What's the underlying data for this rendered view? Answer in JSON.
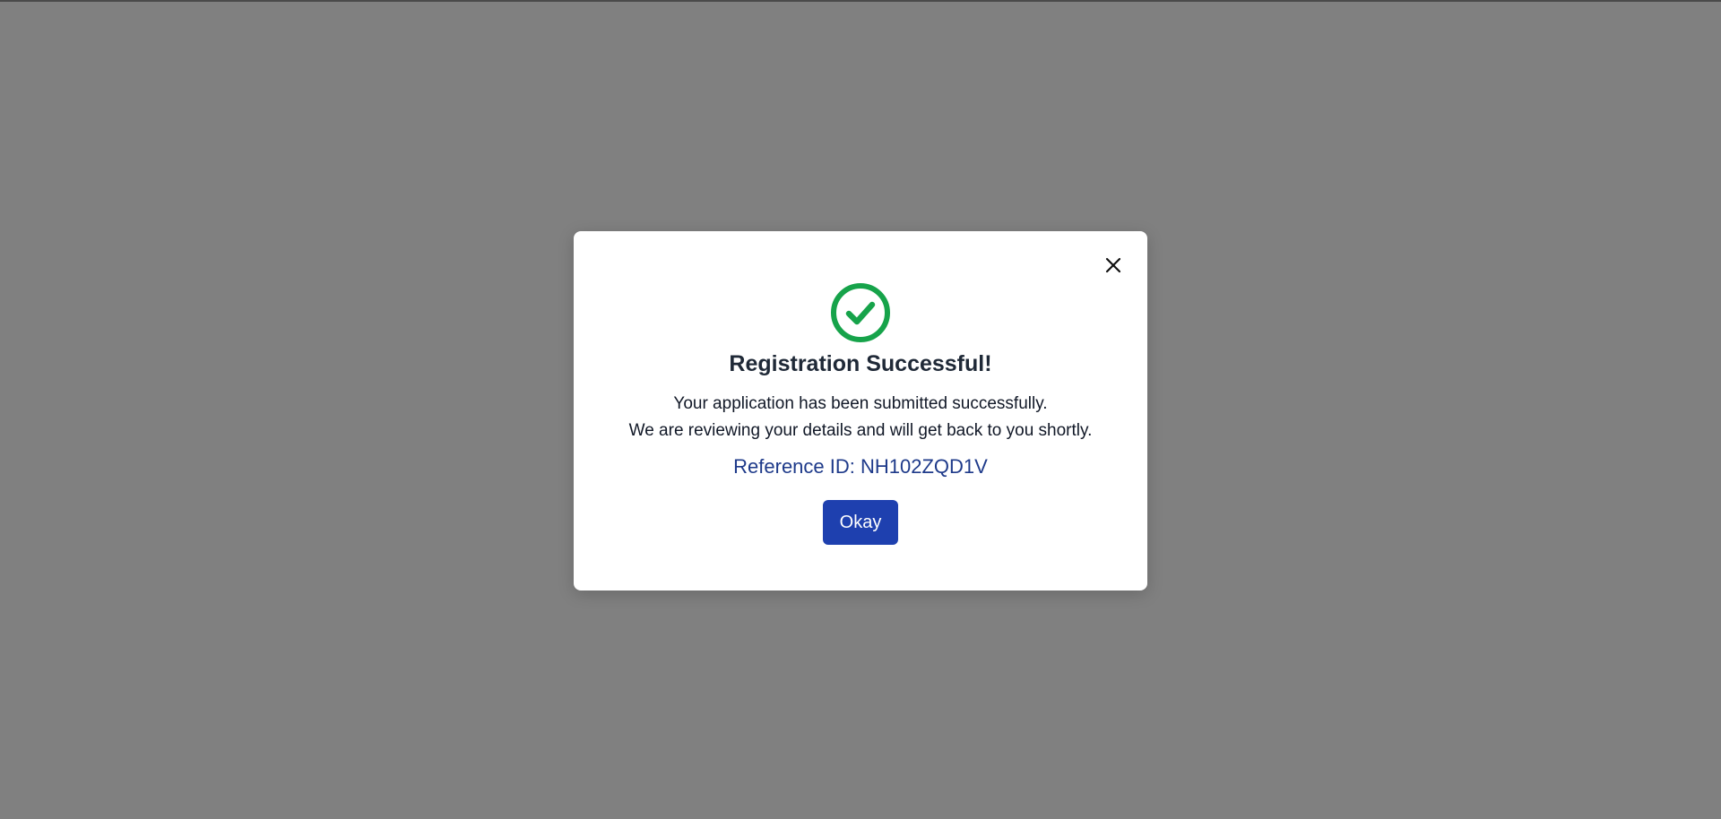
{
  "modal": {
    "title": "Registration Successful!",
    "message_line1": "Your application has been submitted successfully.",
    "message_line2": "We are reviewing your details and will get back to you shortly.",
    "reference_label": "Reference ID:",
    "reference_id": "NH102ZQD1V",
    "okay_label": "Okay",
    "icons": {
      "success": "check-circle-icon",
      "close": "close-icon"
    }
  },
  "colors": {
    "backdrop": "#808080",
    "success_green": "#16a34a",
    "reference_blue": "#1e3a8a",
    "button_blue": "#1e40af"
  }
}
